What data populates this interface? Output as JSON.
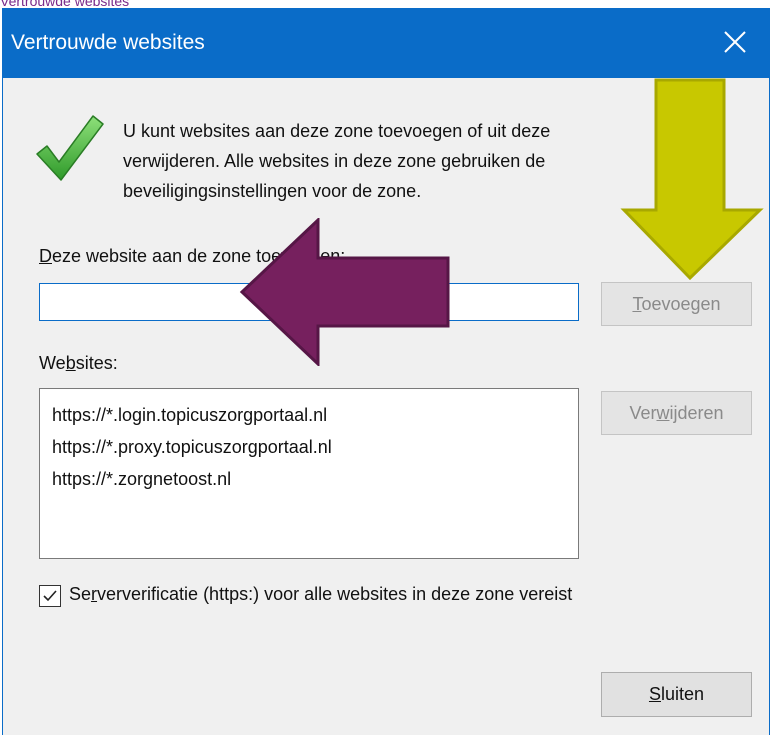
{
  "caption": "Vertrouwde websites",
  "dialog": {
    "title": "Vertrouwde websites",
    "close_icon": "close-icon",
    "description_lines": [
      "U kunt websites aan deze zone toevoegen of uit deze",
      "verwijderen. Alle websites in deze zone gebruiken de",
      "beveiligingsinstellingen voor de zone."
    ],
    "add_label": {
      "mnemonic": "D",
      "rest": "eze website aan de zone toevoegen:"
    },
    "url_input": {
      "value": "",
      "placeholder": ""
    },
    "add_button": {
      "mnemonic": "T",
      "rest": "oevoegen"
    },
    "websites_label": {
      "before": "We",
      "mnemonic": "b",
      "after": "sites:"
    },
    "websites": [
      "https://*.login.topicuszorgportaal.nl",
      "https://*.proxy.topicuszorgportaal.nl",
      "https://*.zorgnetoost.nl"
    ],
    "remove_button": {
      "before": "Ver",
      "mnemonic": "w",
      "after": "ijderen"
    },
    "server_verification": {
      "checked": true,
      "before": "Se",
      "mnemonic": "r",
      "after": "ververificatie (https:) voor alle websites in deze zone vereist"
    },
    "close_button": {
      "mnemonic": "S",
      "rest": "luiten"
    }
  },
  "annotations": {
    "down_arrow_color": "#c8c800",
    "left_arrow_color": "#76205e"
  },
  "colors": {
    "accent": "#0a6cc8",
    "dialog_bg": "#f0f0f0"
  }
}
